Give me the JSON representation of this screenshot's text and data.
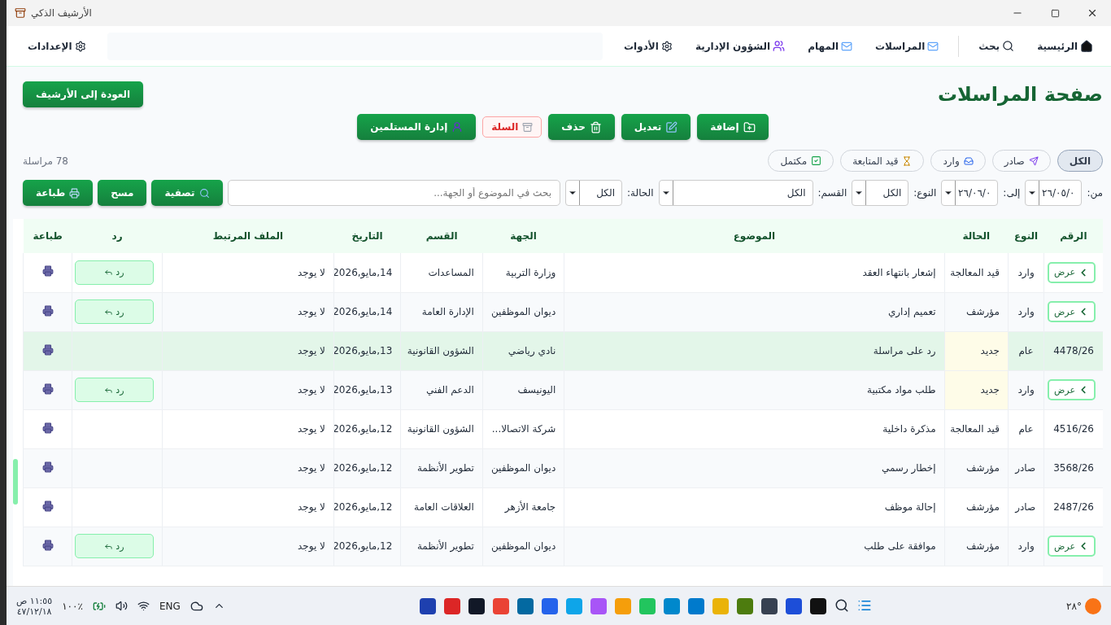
{
  "window": {
    "title": "الأرشيف الذكي"
  },
  "nav": {
    "items": [
      {
        "label": "الرئيسية",
        "kind": "home"
      },
      {
        "label": "بحث",
        "kind": "search"
      },
      {
        "label": "المراسلات",
        "kind": "mail"
      },
      {
        "label": "المهام",
        "kind": "tasks"
      },
      {
        "label": "الشؤون الإدارية",
        "kind": "people"
      },
      {
        "label": "الأدوات",
        "kind": "tools"
      }
    ],
    "settings": {
      "label": "الإعدادات"
    }
  },
  "page": {
    "title": "صفحة المراسلات",
    "back_button": "العودة إلى الأرشيف"
  },
  "actions": [
    {
      "label": "إضافة",
      "kind": "add"
    },
    {
      "label": "تعديل",
      "kind": "edit"
    },
    {
      "label": "حذف",
      "kind": "delete"
    },
    {
      "label": "السلة",
      "kind": "trash"
    },
    {
      "label": "إدارة المستلمين",
      "kind": "recipients"
    }
  ],
  "chips": [
    {
      "label": "الكل",
      "kind": "all",
      "selected": true
    },
    {
      "label": "صادر",
      "kind": "outgoing",
      "selected": false
    },
    {
      "label": "وارد",
      "kind": "incoming",
      "selected": false
    },
    {
      "label": "قيد المتابعة",
      "kind": "pending",
      "selected": false
    },
    {
      "label": "مكتمل",
      "kind": "done",
      "selected": false
    }
  ],
  "count": "78 مراسلة",
  "filters": {
    "selects": [
      {
        "label": "من:",
        "value": "٢٦/٠٥/٠",
        "kind": "date"
      },
      {
        "label": "إلى:",
        "value": "٢٦/٠٦/٠",
        "kind": "date"
      },
      {
        "label": "النوع:",
        "value": "الكل",
        "kind": "small"
      },
      {
        "label": "القسم:",
        "value": "الكل",
        "kind": "wide"
      },
      {
        "label": "الحالة:",
        "value": "الكل",
        "kind": "small"
      }
    ],
    "search": {
      "placeholder": "بحث في الموضوع أو الجهة..."
    },
    "buttons": [
      {
        "label": "تصفية",
        "kind": "filter"
      },
      {
        "label": "مسح",
        "kind": "clear"
      },
      {
        "label": "طباعة",
        "kind": "print"
      }
    ]
  },
  "table": {
    "columns": [
      "الرقم",
      "النوع",
      "الحالة",
      "الموضوع",
      "الجهة",
      "القسم",
      "التاريخ",
      "الملف المرتبط",
      "رد",
      "طباعة"
    ],
    "rows": [
      {
        "kind": "view",
        "view": "عرض",
        "type": "وارد",
        "status": "قيد المعالجة",
        "flagged": false,
        "selected": false,
        "subject": "إشعار بانتهاء العقد",
        "party": "وزارة التربية",
        "department": "المساعدات",
        "date": "14,مايو,2026",
        "file": "لا يوجد",
        "reply": "رد"
      },
      {
        "kind": "view",
        "view": "عرض",
        "type": "وارد",
        "status": "مؤرشف",
        "flagged": false,
        "selected": false,
        "subject": "تعميم إداري",
        "party": "ديوان الموظفين",
        "department": "الإدارة العامة",
        "date": "14,مايو,2026",
        "file": "لا يوجد",
        "reply": "رد"
      },
      {
        "kind": "number",
        "number": "4478/26",
        "type": "عام",
        "status": "جديد",
        "flagged": true,
        "selected": true,
        "subject": "رد على مراسلة",
        "party": "نادي رياضي",
        "department": "الشؤون القانونية",
        "date": "13,مايو,2026",
        "file": "لا يوجد"
      },
      {
        "kind": "view",
        "view": "عرض",
        "type": "وارد",
        "status": "جديد",
        "flagged": true,
        "selected": false,
        "subject": "طلب مواد مكتبية",
        "party": "اليونيسف",
        "department": "الدعم الفني",
        "date": "13,مايو,2026",
        "file": "لا يوجد",
        "reply": "رد"
      },
      {
        "kind": "number",
        "number": "4516/26",
        "type": "عام",
        "status": "قيد المعالجة",
        "flagged": false,
        "selected": false,
        "subject": "مذكرة داخلية",
        "party": "شركة الاتصالا...",
        "department": "الشؤون القانونية",
        "date": "12,مايو,2026",
        "file": "لا يوجد"
      },
      {
        "kind": "number",
        "number": "3568/26",
        "type": "صادر",
        "status": "مؤرشف",
        "flagged": false,
        "selected": false,
        "subject": "إخطار رسمي",
        "party": "ديوان الموظفين",
        "department": "تطوير الأنظمة",
        "date": "12,مايو,2026",
        "file": "لا يوجد"
      },
      {
        "kind": "number",
        "number": "2487/26",
        "type": "صادر",
        "status": "مؤرشف",
        "flagged": false,
        "selected": false,
        "subject": "إحالة موظف",
        "party": "جامعة الأزهر",
        "department": "العلاقات العامة",
        "date": "12,مايو,2026",
        "file": "لا يوجد"
      },
      {
        "kind": "view",
        "view": "عرض",
        "type": "وارد",
        "status": "مؤرشف",
        "flagged": false,
        "selected": false,
        "subject": "موافقة على طلب",
        "party": "ديوان الموظفين",
        "department": "تطوير الأنظمة",
        "date": "12,مايو,2026",
        "file": "لا يوجد",
        "reply": "رد"
      }
    ]
  },
  "taskbar": {
    "time": "١١:٥٥ ص",
    "date": "٤٧/١٢/١٨",
    "battery": "١٠٠٪",
    "language": "ENG",
    "weather": "٢٨°"
  }
}
